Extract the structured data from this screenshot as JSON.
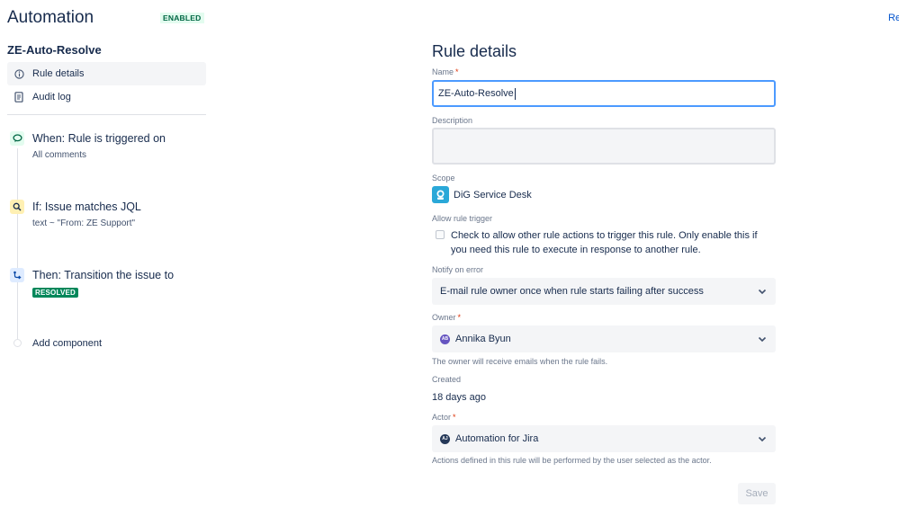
{
  "header": {
    "title": "Automation",
    "status_badge": "ENABLED",
    "top_right_link": "Re"
  },
  "sidebar": {
    "rule_name": "ZE-Auto-Resolve",
    "nav": [
      {
        "label": "Rule details",
        "icon": "info-icon",
        "active": true
      },
      {
        "label": "Audit log",
        "icon": "document-icon",
        "active": false
      }
    ],
    "components": [
      {
        "title": "When: Rule is triggered on",
        "subtitle": "All comments",
        "icon": "comment-trigger-icon",
        "color": "#e3fcef"
      },
      {
        "title": "If: Issue matches JQL",
        "subtitle": "text ~ \"From: ZE Support\"",
        "icon": "search-icon",
        "color": "#fff0b3"
      },
      {
        "title": "Then: Transition the issue to",
        "badge": "RESOLVED",
        "icon": "transition-icon",
        "color": "#deebff"
      }
    ],
    "add_component_label": "Add component"
  },
  "form": {
    "title": "Rule details",
    "name_label": "Name",
    "name_value": "ZE-Auto-Resolve",
    "description_label": "Description",
    "description_value": "",
    "scope_label": "Scope",
    "scope_value": "DiG Service Desk",
    "allow_trigger_label": "Allow rule trigger",
    "allow_trigger_text": "Check to allow other rule actions to trigger this rule. Only enable this if you need this rule to execute in response to another rule.",
    "allow_trigger_checked": false,
    "notify_label": "Notify on error",
    "notify_value": "E-mail rule owner once when rule starts failing after success",
    "owner_label": "Owner",
    "owner_value": "Annika Byun",
    "owner_initials": "AB",
    "owner_helper": "The owner will receive emails when the rule fails.",
    "created_label": "Created",
    "created_value": "18 days ago",
    "actor_label": "Actor",
    "actor_value": "Automation for Jira",
    "actor_initials": "AJ",
    "actor_helper": "Actions defined in this rule will be performed by the user selected as the actor.",
    "save_label": "Save"
  },
  "colors": {
    "accent": "#0052cc",
    "focus_border": "#4c9aff",
    "enabled_bg": "#e3fcef",
    "enabled_text": "#006644",
    "resolved_bg": "#00875a",
    "required": "#de350b"
  }
}
